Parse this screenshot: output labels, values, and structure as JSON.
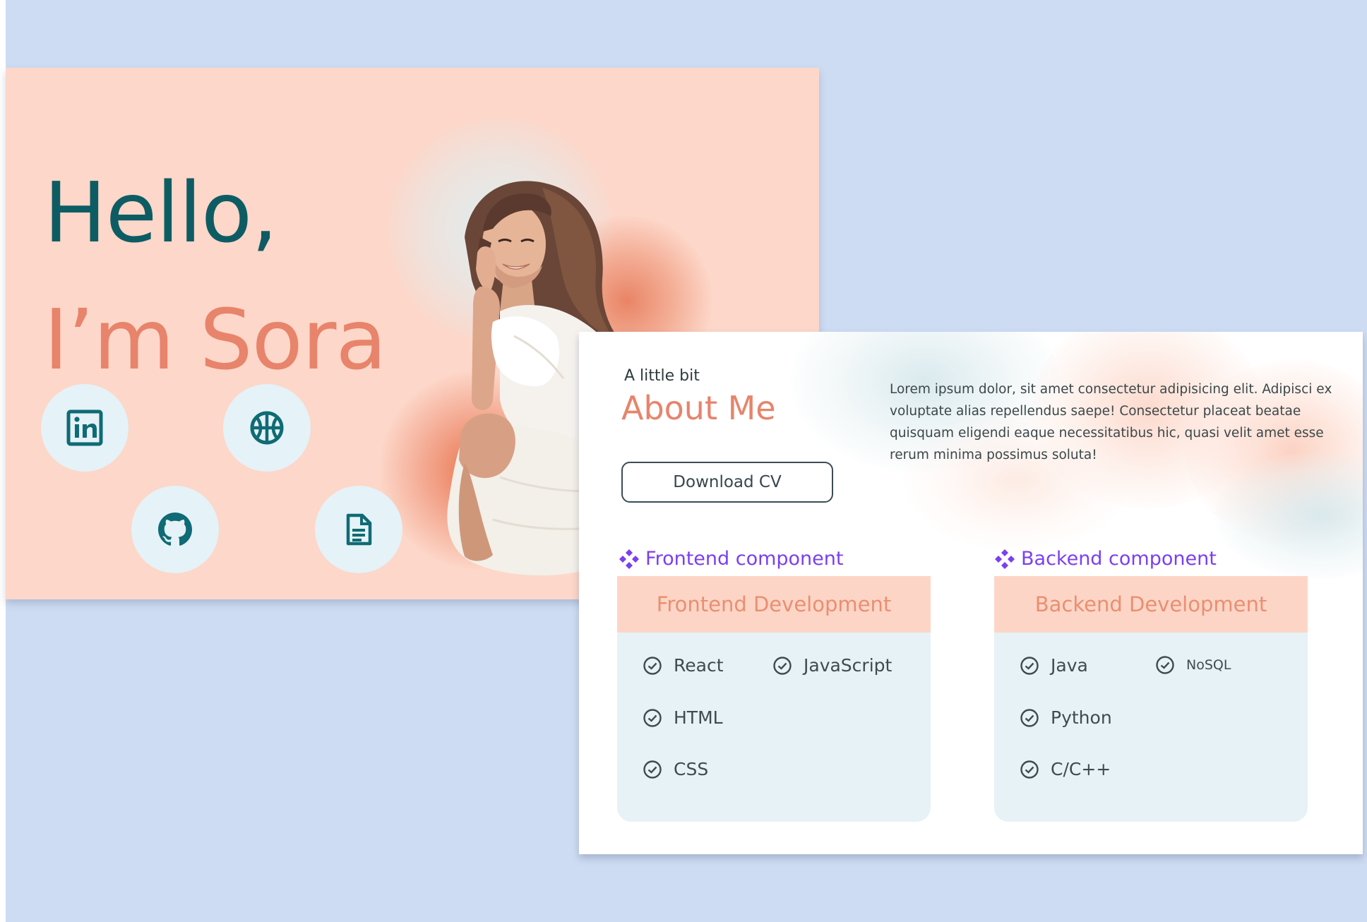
{
  "hero": {
    "greeting": "Hello,",
    "name": "I’m Sora",
    "social": [
      {
        "icon": "linkedin-icon"
      },
      {
        "icon": "dribbble-icon"
      },
      {
        "icon": "github-icon"
      },
      {
        "icon": "document-icon"
      }
    ]
  },
  "about": {
    "kicker": "A little bit",
    "title": "About Me",
    "cv_button": "Download CV",
    "body": "Lorem ipsum dolor, sit amet consectetur adipisicing elit. Adipisci ex voluptate alias repellendus saepe! Consectetur placeat beatae quisquam eligendi eaque necessitatibus hic, quasi velit amet esse rerum minima possimus soluta!"
  },
  "components": {
    "frontend": {
      "label": "Frontend component",
      "header": "Frontend Development",
      "skills": [
        "React",
        "JavaScript",
        "HTML",
        "CSS"
      ]
    },
    "backend": {
      "label": "Backend component",
      "header": "Backend Development",
      "skills": [
        "Java",
        "NoSQL",
        "Python",
        "C/C++"
      ]
    }
  },
  "colors": {
    "page_background": "#cddcf3",
    "hero_background": "#fdd7c9",
    "teal": "#0e5c63",
    "coral": "#e7846b",
    "icon_circle": "#e5f2f7",
    "component_purple": "#7b3ff0",
    "skill_card": "#e7f2f7",
    "skill_header": "#fdd5c6"
  }
}
